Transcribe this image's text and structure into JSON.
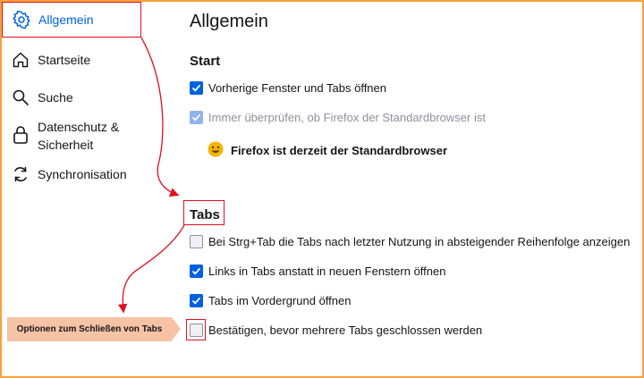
{
  "sidebar": {
    "items": [
      {
        "label": "Allgemein",
        "icon": "gear-icon",
        "active": true
      },
      {
        "label": "Startseite",
        "icon": "home-icon"
      },
      {
        "label": "Suche",
        "icon": "search-icon"
      },
      {
        "label": "Datenschutz & Sicherheit",
        "line1": "Datenschutz &",
        "line2": "Sicherheit",
        "icon": "lock-icon"
      },
      {
        "label": "Synchronisation",
        "icon": "sync-icon"
      }
    ]
  },
  "main": {
    "title": "Allgemein",
    "start": {
      "heading": "Start",
      "restore_session": {
        "label": "Vorherige Fenster und Tabs öffnen",
        "checked": true
      },
      "check_default": {
        "label": "Immer überprüfen, ob Firefox der Standardbrowser ist",
        "checked": true,
        "disabled": true
      },
      "default_status": {
        "emoji": "😀",
        "text": "Firefox ist derzeit der Standardbrowser"
      }
    },
    "tabs": {
      "heading": "Tabs",
      "ctrl_tab": {
        "label": "Bei Strg+Tab die Tabs nach letzter Nutzung in absteigender Reihenfolge anzeigen",
        "checked": false
      },
      "links_in_tabs": {
        "label": "Links in Tabs anstatt in neuen Fenstern öffnen",
        "checked": true
      },
      "foreground": {
        "label": "Tabs im Vordergrund öffnen",
        "checked": true
      },
      "confirm_close": {
        "label": "Bestätigen, bevor mehrere Tabs geschlossen werden",
        "checked": false
      }
    }
  },
  "annotation": {
    "callout": "Optionen zum Schließen von Tabs"
  },
  "colors": {
    "accent": "#0061e0",
    "highlight_border": "#e01020",
    "callout_bg": "#f7c3a5",
    "frame": "#f7a23a"
  }
}
